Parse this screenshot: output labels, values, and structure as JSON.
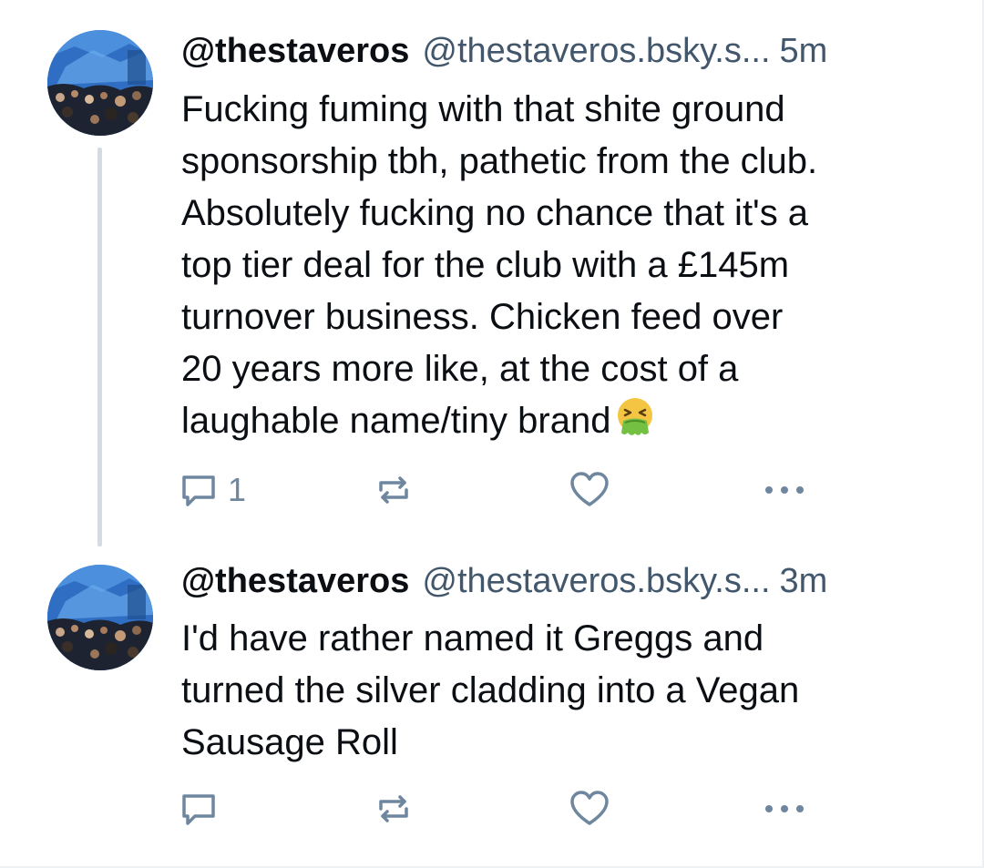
{
  "posts": [
    {
      "display_name": "@thestaveros",
      "handle": "@thestaveros.bsky.s...",
      "time": "5m",
      "text": "Fucking fuming with that shite ground\nsponsorship tbh, pathetic from the club.\nAbsolutely fucking no chance that it's a\ntop tier deal for the club with a £145m\nturnover business. Chicken feed over\n20 years more like, at the cost of a\nlaughable name/tiny brand",
      "emoji": "vomiting-face",
      "reply_count": "1",
      "icons": {
        "reply": "speech-bubble-icon",
        "repost": "repost-arrows-icon",
        "like": "heart-icon",
        "more": "ellipsis-icon"
      }
    },
    {
      "display_name": "@thestaveros",
      "handle": "@thestaveros.bsky.s...",
      "time": "3m",
      "text": "I'd have rather named it Greggs and\nturned the silver cladding into a Vegan\nSausage Roll",
      "reply_count": "",
      "icons": {
        "reply": "speech-bubble-icon",
        "repost": "repost-arrows-icon",
        "like": "heart-icon",
        "more": "ellipsis-icon"
      }
    }
  ],
  "colors": {
    "text": "#0b0f14",
    "muted": "#42576c",
    "icon": "#6f869f",
    "thread_line": "#d4dbe2"
  }
}
